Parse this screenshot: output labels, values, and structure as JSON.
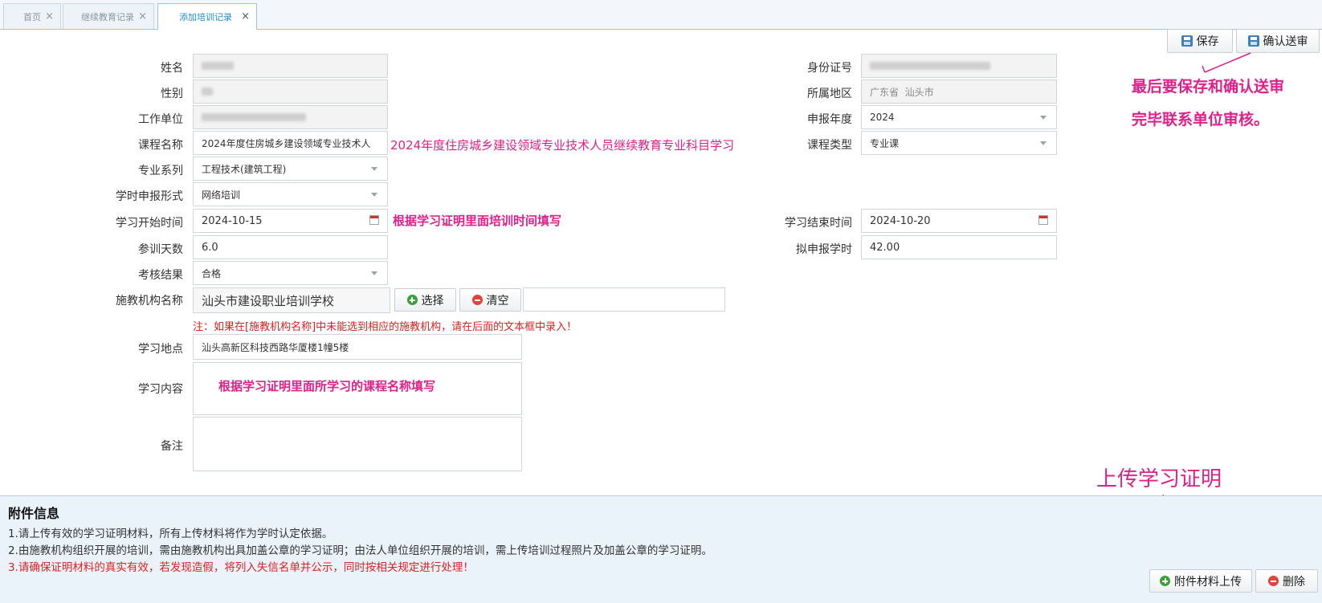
{
  "tabs": [
    {
      "label": "首页",
      "close": "×"
    },
    {
      "label": "继续教育记录",
      "close": "×"
    },
    {
      "label": "添加培训记录",
      "close": "×"
    }
  ],
  "toolbar": {
    "save_label": "保存",
    "confirm_label": "确认送审"
  },
  "form": {
    "name_label": "姓名",
    "gender_label": "性别",
    "work_unit_label": "工作单位",
    "course_name_label": "课程名称",
    "course_name_value": "2024年度住房城乡建设领域专业技术人",
    "major_label": "专业系列",
    "major_value": "工程技术(建筑工程)",
    "hours_form_label": "学时申报形式",
    "hours_form_value": "网络培训",
    "start_label": "学习开始时间",
    "start_value": "2024-10-15",
    "days_label": "参训天数",
    "days_value": "6.0",
    "result_label": "考核结果",
    "result_value": "合格",
    "institution_label": "施教机构名称",
    "institution_value": "汕头市建设职业培训学校",
    "select_label": "选择",
    "clear_label": "清空",
    "institution_note": "注：如果在[施教机构名称]中未能选到相应的施教机构，请在后面的文本框中录入！",
    "location_label": "学习地点",
    "location_value": "汕头高新区科技西路华厦楼1幢5楼",
    "content_label": "学习内容",
    "remark_label": "备注",
    "id_label": "身份证号",
    "region_label": "所属地区",
    "region_value": "广东省  汕头市",
    "year_label": "申报年度",
    "year_value": "2024",
    "course_type_label": "课程类型",
    "course_type_value": "专业课",
    "end_label": "学习结束时间",
    "end_value": "2024-10-20",
    "planned_hours_label": "拟申报学时",
    "planned_hours_value": "42.00"
  },
  "annotations": {
    "course_full_name": "2024年度住房城乡建设领域专业技术人员继续教育专业科目学习",
    "time_hint": "根据学习证明里面培训时间填写",
    "content_hint": "根据学习证明里面所学习的课程名称填写",
    "save_hint_line1": "最后要保存和确认送审",
    "save_hint_line2": "完毕联系单位审核。",
    "upload_hint": "上传学习证明"
  },
  "attachments": {
    "title": "附件信息",
    "line1": "1.请上传有效的学习证明材料，所有上传材料将作为学时认定依据。",
    "line2": "2.由施教机构组织开展的培训，需由施教机构出具加盖公章的学习证明；由法人单位组织开展的培训，需上传培训过程照片及加盖公章的学习证明。",
    "line3": "3.请确保证明材料的真实有效，若发现造假，将列入失信名单并公示，同时按相关规定进行处理！",
    "upload_label": "附件材料上传",
    "delete_label": "删除"
  },
  "colors": {
    "accent": "#1e90d6",
    "annotation": "#e0208a",
    "warning": "#dd2222"
  }
}
